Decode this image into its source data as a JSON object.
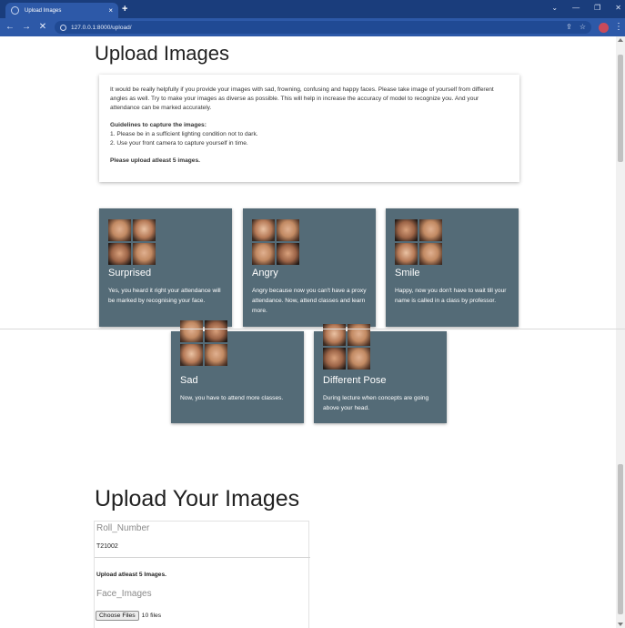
{
  "browser": {
    "tab_title": "Upload Images",
    "tab_close": "×",
    "new_tab": "+",
    "url": "127.0.0.1:8000/upload/",
    "nav": {
      "back": "←",
      "forward": "→",
      "stop": "✕"
    },
    "window_controls": [
      "⌄",
      "—",
      "❐",
      "✕"
    ],
    "toolbar_icons": [
      "share-icon",
      "star-icon"
    ],
    "avatar_color": "#c94a5a"
  },
  "page": {
    "heading": "Upload Images",
    "intro": "It would be really helpfully if you provide your images with sad, frowning, confusing and happy faces. Please take image of yourself from different angles as well. Try to make your images as diverse as possible. This will help in increase the accuracy of model to recognize you. And your attendance can be marked accurately.",
    "guidelines_title": "Guidelines to capture the images:",
    "guidelines": [
      "1. Please be in a sufficient lighting condition not to dark.",
      "2. Use your front camera to capture yourself in time."
    ],
    "upload_note": "Please upload atleast 5 images.",
    "card_color": "#546b77",
    "cards": [
      {
        "title": "Surprised",
        "text": "Yes, you heard it right your attendance will be marked by recognising your face."
      },
      {
        "title": "Angry",
        "text": "Angry because now you can't have a proxy attendance. Now, attend classes and learn more."
      },
      {
        "title": "Smile",
        "text": "Happy, now you don't have to wait till your name is called in a class by professor."
      },
      {
        "title": "Sad",
        "text": "Now, you have to attend more classes."
      },
      {
        "title": "Different Pose",
        "text": "During lecture when concepts are going above your head."
      }
    ],
    "form_heading": "Upload Your Images",
    "roll_label": "Roll_Number",
    "roll_value": "T21002",
    "form_note": "Upload atleast 5 Images.",
    "images_label": "Face_Images",
    "file_button": "Choose Files",
    "file_count": "10 files"
  }
}
